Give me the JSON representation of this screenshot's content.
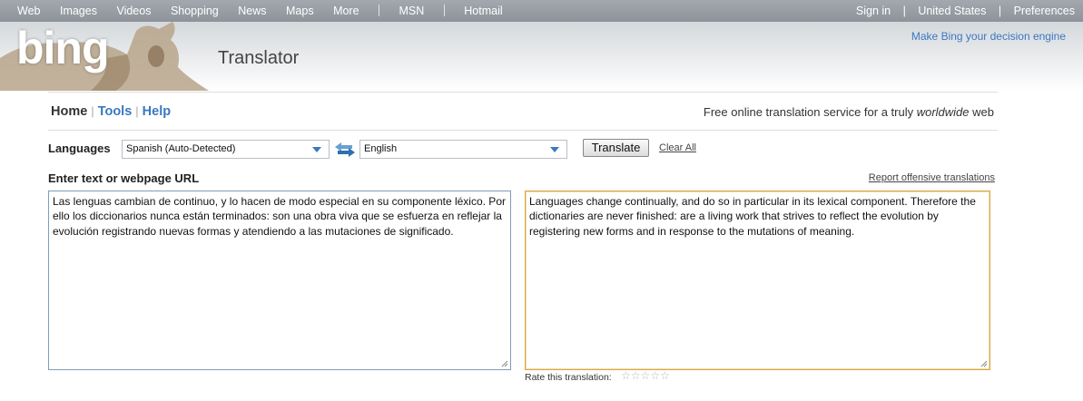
{
  "topnav": {
    "left": [
      "Web",
      "Images",
      "Videos",
      "Shopping",
      "News",
      "Maps",
      "More"
    ],
    "after_sep": [
      "MSN",
      "Hotmail"
    ],
    "right": [
      "Sign in",
      "United States",
      "Preferences"
    ]
  },
  "header": {
    "logo": "bing",
    "product": "Translator",
    "tagline": "Make Bing your decision engine"
  },
  "subnav": {
    "home": "Home",
    "tools": "Tools",
    "help": "Help",
    "pipe": "|",
    "description_prefix": "Free online translation service for a truly ",
    "description_em": "worldwide",
    "description_suffix": " web"
  },
  "languages": {
    "label": "Languages",
    "from": "Spanish (Auto-Detected)",
    "to": "English",
    "translate_button": "Translate",
    "clear_all": "Clear All"
  },
  "input": {
    "label": "Enter text or webpage URL",
    "report_link": "Report offensive translations",
    "source_text": "Las lenguas cambian de continuo, y lo hacen de modo especial en su componente léxico. Por ello los diccionarios nunca están terminados: son una obra viva que se esfuerza en reflejar la evolución registrando nuevas formas y atendiendo a las mutaciones de significado.",
    "translated_text": "Languages change continually, and do so in particular in its lexical component. Therefore the dictionaries are never finished: are a living work that strives to reflect the evolution by registering new forms and in response to the mutations of meaning."
  },
  "rating": {
    "label": "Rate this translation:",
    "stars": "☆☆☆☆☆",
    "value": 0,
    "max": 5
  },
  "colors": {
    "link": "#3a78c0",
    "output_border": "#d7a84a",
    "input_border": "#7f9db9"
  }
}
